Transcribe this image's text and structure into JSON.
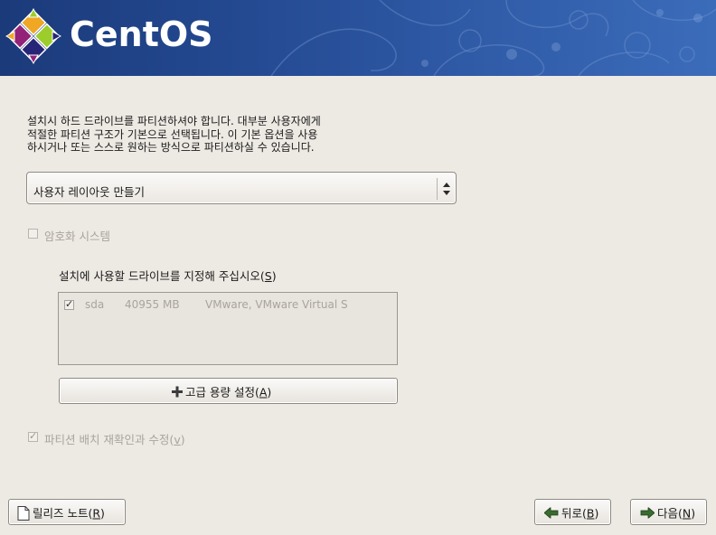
{
  "brand": {
    "name": "CentOS"
  },
  "intro": {
    "line1": "설치시 하드 드라이브를 파티션하셔야 합니다. 대부분 사용자에게",
    "line2": "적절한 파티션 구조가 기본으로 선택됩니다. 이 기본 옵션을 사용",
    "line3": "하시거나 또는 스스로 원하는 방식으로 파티션하실 수 있습니다."
  },
  "layout_select": {
    "selected": "사용자 레이아웃 만들기"
  },
  "encrypt": {
    "label": "암호화 시스템",
    "checked": false,
    "enabled": false
  },
  "drives": {
    "heading": "설치에 사용할 드라이브를 지정해 주십시오(",
    "heading_key": "S",
    "heading_end": ")",
    "rows": [
      {
        "checked": true,
        "name": "sda",
        "size": "40955 MB",
        "model": "VMware, VMware Virtual S"
      }
    ]
  },
  "advanced_button": {
    "label": "고급 용량 설정(",
    "key": "A",
    "end": ")",
    "icon": "plus-icon"
  },
  "review": {
    "label": "파티션 배치 재확인과 수정(",
    "key": "v",
    "end": ")",
    "checked": true,
    "enabled": false
  },
  "footer": {
    "release_notes": {
      "label": "릴리즈 노트(",
      "key": "R",
      "end": ")",
      "icon": "document-icon"
    },
    "back": {
      "label": "뒤로(",
      "key": "B",
      "end": ")",
      "icon": "arrow-left-icon"
    },
    "next": {
      "label": "다음(",
      "key": "N",
      "end": ")",
      "icon": "arrow-right-icon"
    }
  },
  "colors": {
    "banner": "#244a92",
    "background": "#ede9e3",
    "arrow": "#3a6b2f"
  }
}
